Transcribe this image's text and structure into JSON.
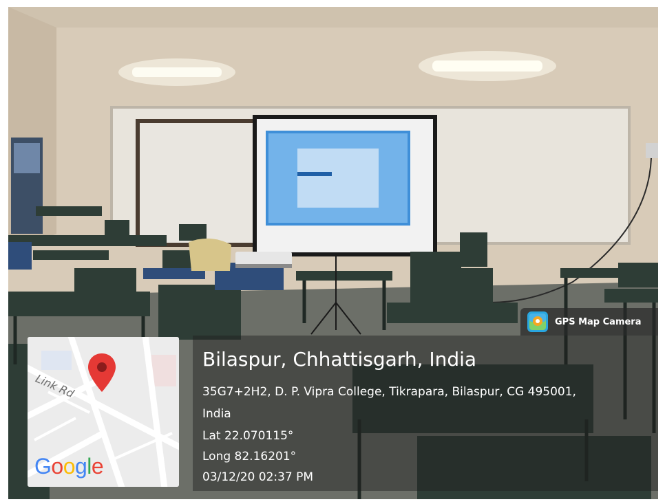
{
  "badge": {
    "label": "GPS Map Camera",
    "icon": "gps-map-camera-icon"
  },
  "location": {
    "title": "Bilaspur, Chhattisgarh, India",
    "address_line1": "35G7+2H2, D. P. Vipra College, Tikrapara, Bilaspur, CG 495001,",
    "address_line2": "India",
    "lat": "Lat 22.070115°",
    "long": "Long 82.16201°",
    "datetime": "03/12/20 02:37 PM"
  },
  "map": {
    "road_label": "Link Rd",
    "google_letters": [
      "G",
      "o",
      "o",
      "g",
      "l",
      "e"
    ],
    "google_colors": [
      "#4285F4",
      "#EA4335",
      "#FBBC05",
      "#4285F4",
      "#34A853",
      "#EA4335"
    ],
    "pin_color": "#E53935",
    "pin_icon": "map-pin-icon"
  }
}
